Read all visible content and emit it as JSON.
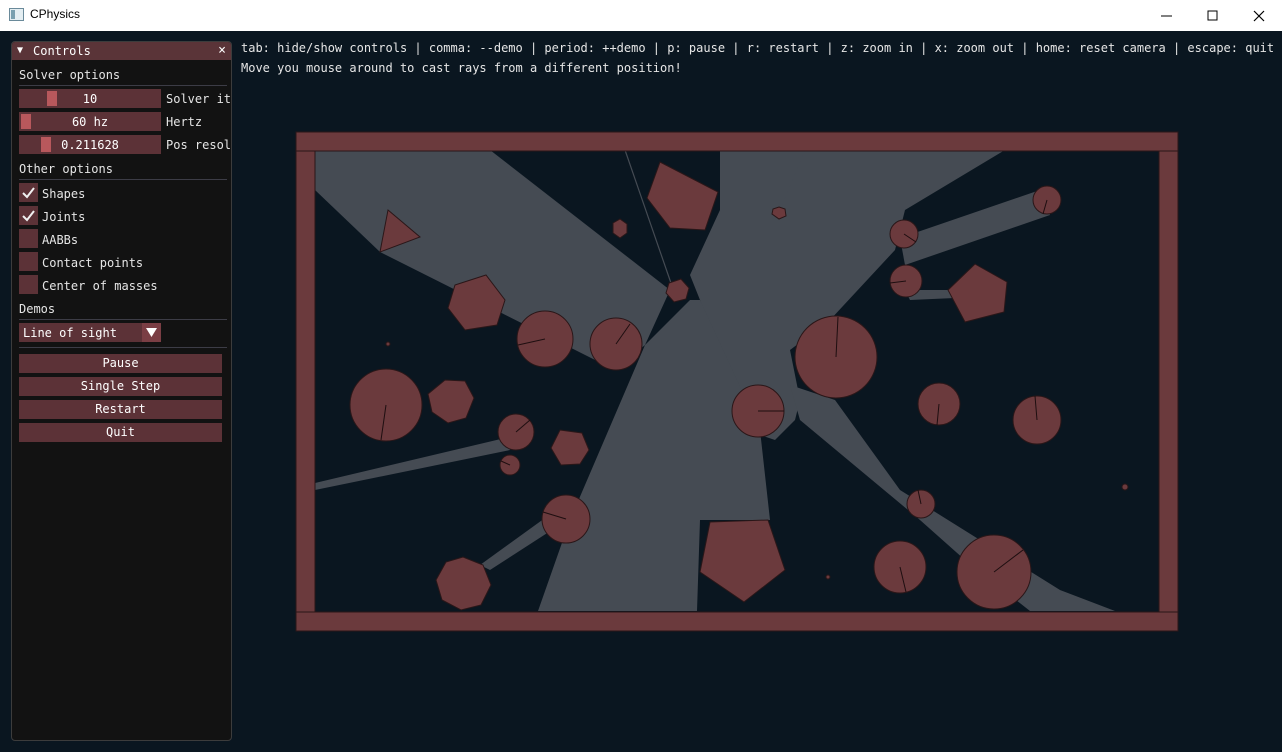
{
  "window": {
    "title": "CPhysics"
  },
  "help": {
    "line1": "tab: hide/show controls | comma: --demo | period: ++demo | p: pause | r: restart | z: zoom in | x: zoom out | home: reset camera | escape: quit",
    "line2": "Move you mouse around to cast rays from a different position!"
  },
  "controls": {
    "title": "Controls",
    "solver_section": "Solver options",
    "sliders": [
      {
        "value": "10",
        "label": "Solver it",
        "fraction": 0.2
      },
      {
        "value": "60 hz",
        "label": "Hertz",
        "fraction": 0.0
      },
      {
        "value": "0.211628",
        "label": "Pos resol",
        "fraction": 0.16
      }
    ],
    "other_section": "Other options",
    "checkboxes": [
      {
        "label": "Shapes",
        "checked": true
      },
      {
        "label": "Joints",
        "checked": true
      },
      {
        "label": "AABBs",
        "checked": false
      },
      {
        "label": "Contact points",
        "checked": false
      },
      {
        "label": "Center of masses",
        "checked": false
      }
    ],
    "demos_section": "Demos",
    "demo_selected": "Line of sight",
    "buttons": {
      "pause": "Pause",
      "single_step": "Single Step",
      "restart": "Restart",
      "quit": "Quit"
    }
  },
  "colors": {
    "wall": "#6b3a3d",
    "body": "#6b3a3d",
    "ray_light": "#454b53",
    "background": "#0a1620",
    "panel_header": "#5a3438"
  },
  "icons": {
    "minimize": "minimize-icon",
    "maximize": "maximize-icon",
    "close": "close-icon",
    "panel_close": "close-icon",
    "collapse": "triangle-down-icon",
    "dropdown": "triangle-down-icon"
  }
}
